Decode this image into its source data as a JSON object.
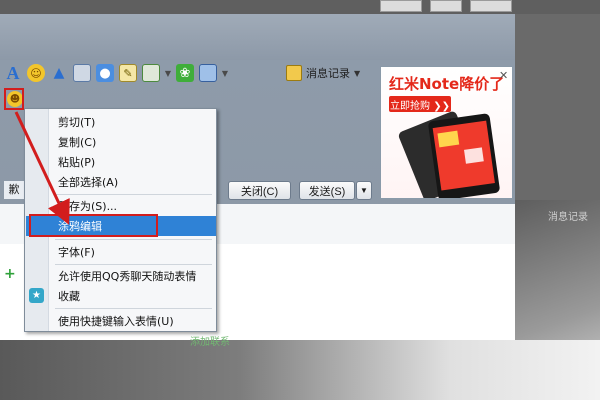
{
  "toolbar": {
    "font_icon_label": "A",
    "history_label": "消息记录"
  },
  "buttons": {
    "close_label": "关闭(C)",
    "send_label": "发送(S)"
  },
  "bottom_tab_label": "歉",
  "context_menu": {
    "items": [
      {
        "label": "剪切(T)"
      },
      {
        "label": "复制(C)"
      },
      {
        "label": "粘贴(P)"
      },
      {
        "label": "全部选择(A)"
      },
      {
        "label": "另存为(S)..."
      },
      {
        "label": "涂鸦编辑"
      },
      {
        "label": "字体(F)"
      },
      {
        "label": "允许使用QQ秀聊天随动表情"
      },
      {
        "label": "收藏"
      },
      {
        "label": "使用快捷键输入表情(U)"
      }
    ],
    "selected_index": 5
  },
  "ad": {
    "title": "红米Note降价了",
    "cta": "立即抢购 ❯❯",
    "close_symbol": "✕"
  },
  "right_label": "消息记录",
  "bottom_text": "添加联系",
  "colors": {
    "menu_selected": "#2f82d6",
    "annotation_red": "#d21d1d",
    "ad_red": "#e4281a"
  }
}
